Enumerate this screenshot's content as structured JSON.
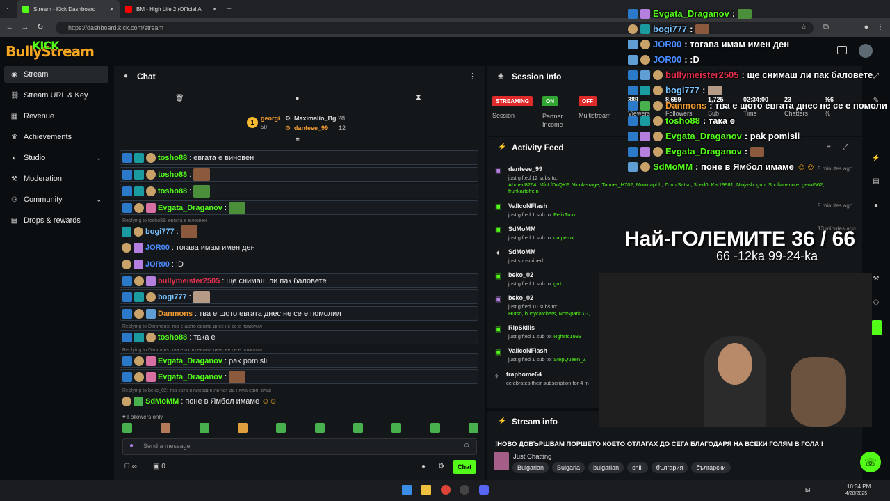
{
  "browser": {
    "tabs": [
      {
        "label": "Stream - Kick Dashboard"
      },
      {
        "label": "BM - High Life 2 (Official A"
      }
    ],
    "url": "https://dashboard.kick.com/stream",
    "new_tab": "+"
  },
  "brand": {
    "logo_text": "BullyStream",
    "kick_text": "KICK"
  },
  "sidebar": {
    "items": [
      {
        "label": "Stream",
        "icon": "stream-icon"
      },
      {
        "label": "Stream URL & Key",
        "icon": "link-icon"
      },
      {
        "label": "Revenue",
        "icon": "revenue-icon"
      },
      {
        "label": "Achievements",
        "icon": "trophy-icon"
      },
      {
        "label": "Studio",
        "icon": "studio-icon"
      },
      {
        "label": "Moderation",
        "icon": "moderation-icon"
      },
      {
        "label": "Community",
        "icon": "community-icon"
      },
      {
        "label": "Drops & rewards",
        "icon": "drops-icon"
      }
    ]
  },
  "chat": {
    "title": "Chat",
    "leaderboard": {
      "rank": "1",
      "first_name": "georgi",
      "first_count": "50",
      "second_name": "Maximalio_Bg",
      "second_count": "28",
      "third_name": "danteee_99",
      "third_count": "12"
    },
    "messages": [
      {
        "user": "tosho88",
        "color": "#53fc18",
        "text": "евгата е виновен"
      },
      {
        "user": "tosho88",
        "color": "#53fc18",
        "text": ""
      },
      {
        "user": "tosho88",
        "color": "#53fc18",
        "text": ""
      },
      {
        "user": "Evgata_Draganov",
        "color": "#53fc18",
        "text": ""
      },
      {
        "reply": "Replying to tosho88: евгата е виновен",
        "user": "bogi777",
        "color": "#79c3ff",
        "text": ""
      },
      {
        "user": "JOR00",
        "color": "#4a8cff",
        "text": "тогава имам имен ден"
      },
      {
        "user": "JOR00",
        "color": "#4a8cff",
        "text": ":D"
      },
      {
        "user": "bullymeister2505",
        "color": "#e5304d",
        "text": "ще снимаш ли пак баловете"
      },
      {
        "user": "bogi777",
        "color": "#79c3ff",
        "text": ""
      },
      {
        "user": "Danmons",
        "color": "#f39c32",
        "text": "тва е щото евгата днес не се е помолил"
      },
      {
        "reply": "Replying to Danmons: тва е щото евгата днес не се е помолил",
        "user": "tosho88",
        "color": "#53fc18",
        "text": "така е"
      },
      {
        "reply": "Replying to Danmons: тва е щото евгата днес не се е помолил",
        "user": "Evgata_Draganov",
        "color": "#53fc18",
        "text": "pak pomisli"
      },
      {
        "user": "Evgata_Draganov",
        "color": "#53fc18",
        "text": ""
      },
      {
        "reply": "Replying to beko_02: тва като в пловдив ли чат да няма един влак",
        "user": "SdMoMM",
        "color": "#53fc18",
        "text": "поне в Ямбол имаме"
      }
    ],
    "followers_only": "Followers only",
    "input_placeholder": "Send a message",
    "footer_count": "0",
    "footer_infinity": "∞",
    "send_label": "Chat"
  },
  "session": {
    "title": "Session Info",
    "streaming": "STREAMING",
    "session_label": "Session",
    "on": "ON",
    "partner_income": "Partner Income",
    "off": "OFF",
    "multistream": "Multistream",
    "stats": [
      {
        "value": "389",
        "label": "Viewers"
      },
      {
        "value": "8,659",
        "label": "Followers"
      },
      {
        "value": "1,725",
        "label": "Sub"
      },
      {
        "value": "02:34:00",
        "label": "Time"
      },
      {
        "value": "23",
        "label": "Chatters"
      },
      {
        "value": "%6",
        "label": "%"
      }
    ]
  },
  "activity": {
    "title": "Activity Feed",
    "events": [
      {
        "name": "danteee_99",
        "line": "just gifted 12 subs to:",
        "targets": "Ahmed8264, MfcLfDvQKF, Nicolasrage, Tanner_H702, Monicaphh, ZonbiSatsu, 3bed0, Kat19981, Ninjashogun, Soufianenote, geoV562, fruhkartoffeln",
        "time": "5 minutes ago"
      },
      {
        "name": "VallcoNFlash",
        "line": "just gifted 1 sub to:",
        "targets": "FelixTron",
        "time": "8 minutes ago"
      },
      {
        "name": "SdMoMM",
        "line": "just gifted 1 sub to:",
        "targets": "datperox",
        "time": "13 minutes ago"
      },
      {
        "name": "SdMoMM",
        "line": "just subscribed",
        "targets": "",
        "time": ""
      },
      {
        "name": "beko_02",
        "line": "just gifted 1 sub to:",
        "targets": "grrt",
        "time": ""
      },
      {
        "name": "beko_02",
        "line": "just gifted 10 subs to:",
        "targets": "H0tso, b0dycatchers, NotSparkGG,",
        "time": ""
      },
      {
        "name": "RipSkills",
        "line": "just gifted 1 sub to:",
        "targets": "Rghsfc1983",
        "time": ""
      },
      {
        "name": "VallcoNFlash",
        "line": "just gifted 1 sub to:",
        "targets": "StepQueen_Z",
        "time": ""
      },
      {
        "name": "traphome64",
        "line": "celebrates their subscription for 4 m",
        "targets": "",
        "time": ""
      }
    ]
  },
  "stream_info": {
    "title": "Stream info",
    "stream_title": "!НОВО ДОВЪРШВАМ ПОРШЕТО КОЕТО ОТЛАГАХ ДО СЕГА БЛАГОДАРЯ НА ВСЕКИ ГОЛЯМ В ГОЛА !",
    "category": "Just Chatting",
    "tags": [
      "Bulgarian",
      "Bulgaria",
      "bulgarian",
      "chill",
      "българия",
      "български"
    ]
  },
  "overlay": {
    "chat": [
      {
        "user": "Evgata_Draganov",
        "color": "#53fc18",
        "text": ":"
      },
      {
        "user": "bogi777",
        "color": "#79c3ff",
        "text": ":"
      },
      {
        "user": "JOR00",
        "color": "#4a8cff",
        "text": ": тогава имам имен ден"
      },
      {
        "user": "JOR00",
        "color": "#4a8cff",
        "text": ": :D"
      },
      {
        "user": "bullymeister2505",
        "color": "#e5304d",
        "text": ": ще снимаш ли пак баловете"
      },
      {
        "user": "bogi777",
        "color": "#79c3ff",
        "text": ":"
      },
      {
        "user": "Danmons",
        "color": "#f39c32",
        "text": ": тва е щото евгата днес не се е помоли"
      },
      {
        "user": "tosho88",
        "color": "#53fc18",
        "text": ": така е"
      },
      {
        "user": "Evgata_Draganov",
        "color": "#53fc18",
        "text": ": pak pomisli"
      },
      {
        "user": "Evgata_Draganov",
        "color": "#53fc18",
        "text": ":"
      },
      {
        "user": "SdMoMM",
        "color": "#53fc18",
        "text": ": поне в Ямбол имаме"
      }
    ],
    "big_title": "Най-ГОЛЕМИТЕ 36 / 66",
    "subtitle": "66 -12ka 99-24-ka"
  },
  "taskbar": {
    "time": "10:34 PM",
    "date": "4/28/2025",
    "lang": "БГ"
  }
}
